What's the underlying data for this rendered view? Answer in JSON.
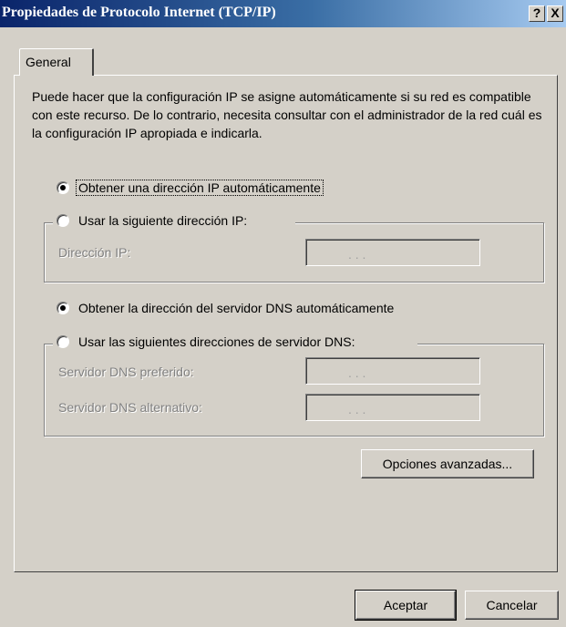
{
  "window": {
    "title": "Propiedades de Protocolo Internet (TCP/IP)",
    "help_label": "?",
    "close_label": "X"
  },
  "tabs": [
    {
      "label": "General",
      "selected": true
    }
  ],
  "description": "Puede hacer que la configuración IP se asigne automáticamente si su red es compatible con este recurso. De lo contrario, necesita consultar con el administrador de la red cuál es la configuración IP apropiada e indicarla.",
  "ip": {
    "auto": {
      "label": "Obtener una dirección IP automáticamente",
      "selected": true
    },
    "manual": {
      "label": "Usar la siguiente dirección IP:",
      "selected": false
    },
    "address_label": "Dirección IP:",
    "address_value": "",
    "address_dots": ".  .  ."
  },
  "dns": {
    "auto": {
      "label": "Obtener la dirección del servidor DNS automáticamente",
      "selected": true
    },
    "manual": {
      "label": "Usar las siguientes direcciones de servidor DNS:",
      "selected": false
    },
    "preferred_label": "Servidor DNS preferido:",
    "preferred_value": "",
    "alternate_label": "Servidor DNS alternativo:",
    "alternate_value": ""
  },
  "buttons": {
    "advanced": "Opciones avanzadas...",
    "ok": "Aceptar",
    "cancel": "Cancelar"
  }
}
